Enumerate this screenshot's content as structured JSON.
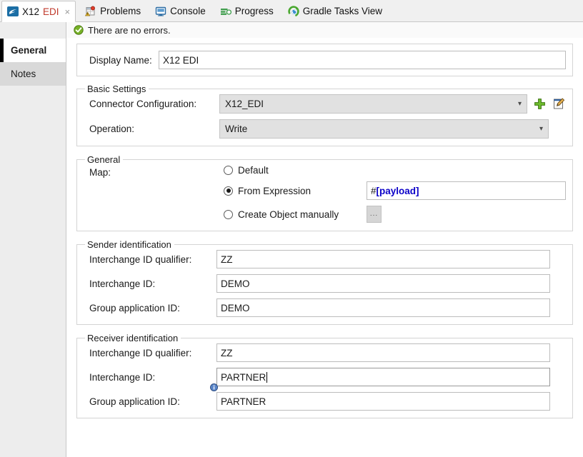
{
  "tabs": [
    {
      "label": "X12 EDI",
      "label_part1": "X12 ",
      "label_part2": "EDI",
      "icon": "mule-connector-icon",
      "active": true,
      "closable": true,
      "close_glyph": "×"
    },
    {
      "label": "Problems",
      "icon": "problems-icon",
      "active": false,
      "closable": false
    },
    {
      "label": "Console",
      "icon": "console-icon",
      "active": false,
      "closable": false
    },
    {
      "label": "Progress",
      "icon": "progress-icon",
      "active": false,
      "closable": false
    },
    {
      "label": "Gradle Tasks View",
      "icon": "gradle-refresh-icon",
      "active": false,
      "closable": false
    }
  ],
  "sidebar": {
    "items": [
      {
        "label": "General",
        "selected": true
      },
      {
        "label": "Notes",
        "selected": false
      }
    ]
  },
  "status": {
    "icon": "success-check-icon",
    "message": "There are no errors."
  },
  "display_name": {
    "label": "Display Name:",
    "value": "X12 EDI"
  },
  "basic_settings": {
    "legend": "Basic Settings",
    "connector_configuration": {
      "label": "Connector Configuration:",
      "value": "X12_EDI",
      "add_icon": "green-plus-icon",
      "edit_icon": "edit-pencil-icon"
    },
    "operation": {
      "label": "Operation:",
      "value": "Write"
    }
  },
  "general_group": {
    "legend": "General",
    "map_label": "Map:",
    "options": [
      {
        "label": "Default",
        "selected": false
      },
      {
        "label": "From Expression",
        "selected": true
      },
      {
        "label": "Create Object manually",
        "selected": false
      }
    ],
    "expression": {
      "prefix": "#",
      "body": "[payload]"
    },
    "browse_button_label": "..."
  },
  "sender_identification": {
    "legend": "Sender identification",
    "fields": [
      {
        "label": "Interchange ID qualifier:",
        "value": "ZZ",
        "focused": false,
        "info": false
      },
      {
        "label": "Interchange ID:",
        "value": "DEMO",
        "focused": false,
        "info": false
      },
      {
        "label": "Group application ID:",
        "value": "DEMO",
        "focused": false,
        "info": false
      }
    ]
  },
  "receiver_identification": {
    "legend": "Receiver identification",
    "fields": [
      {
        "label": "Interchange ID qualifier:",
        "value": "ZZ",
        "focused": false,
        "info": false
      },
      {
        "label": "Interchange ID:",
        "value": "PARTNER",
        "focused": true,
        "info": true,
        "info_icon": "info-badge-icon"
      },
      {
        "label": "Group application ID:",
        "value": "PARTNER",
        "focused": false,
        "info": false
      }
    ]
  },
  "colors": {
    "accent_red": "#c0392b",
    "expression_blue": "#0b00c8",
    "success_green": "#6aab2b",
    "selected_bar": "#000000",
    "combo_bg": "#e1e1e1"
  }
}
